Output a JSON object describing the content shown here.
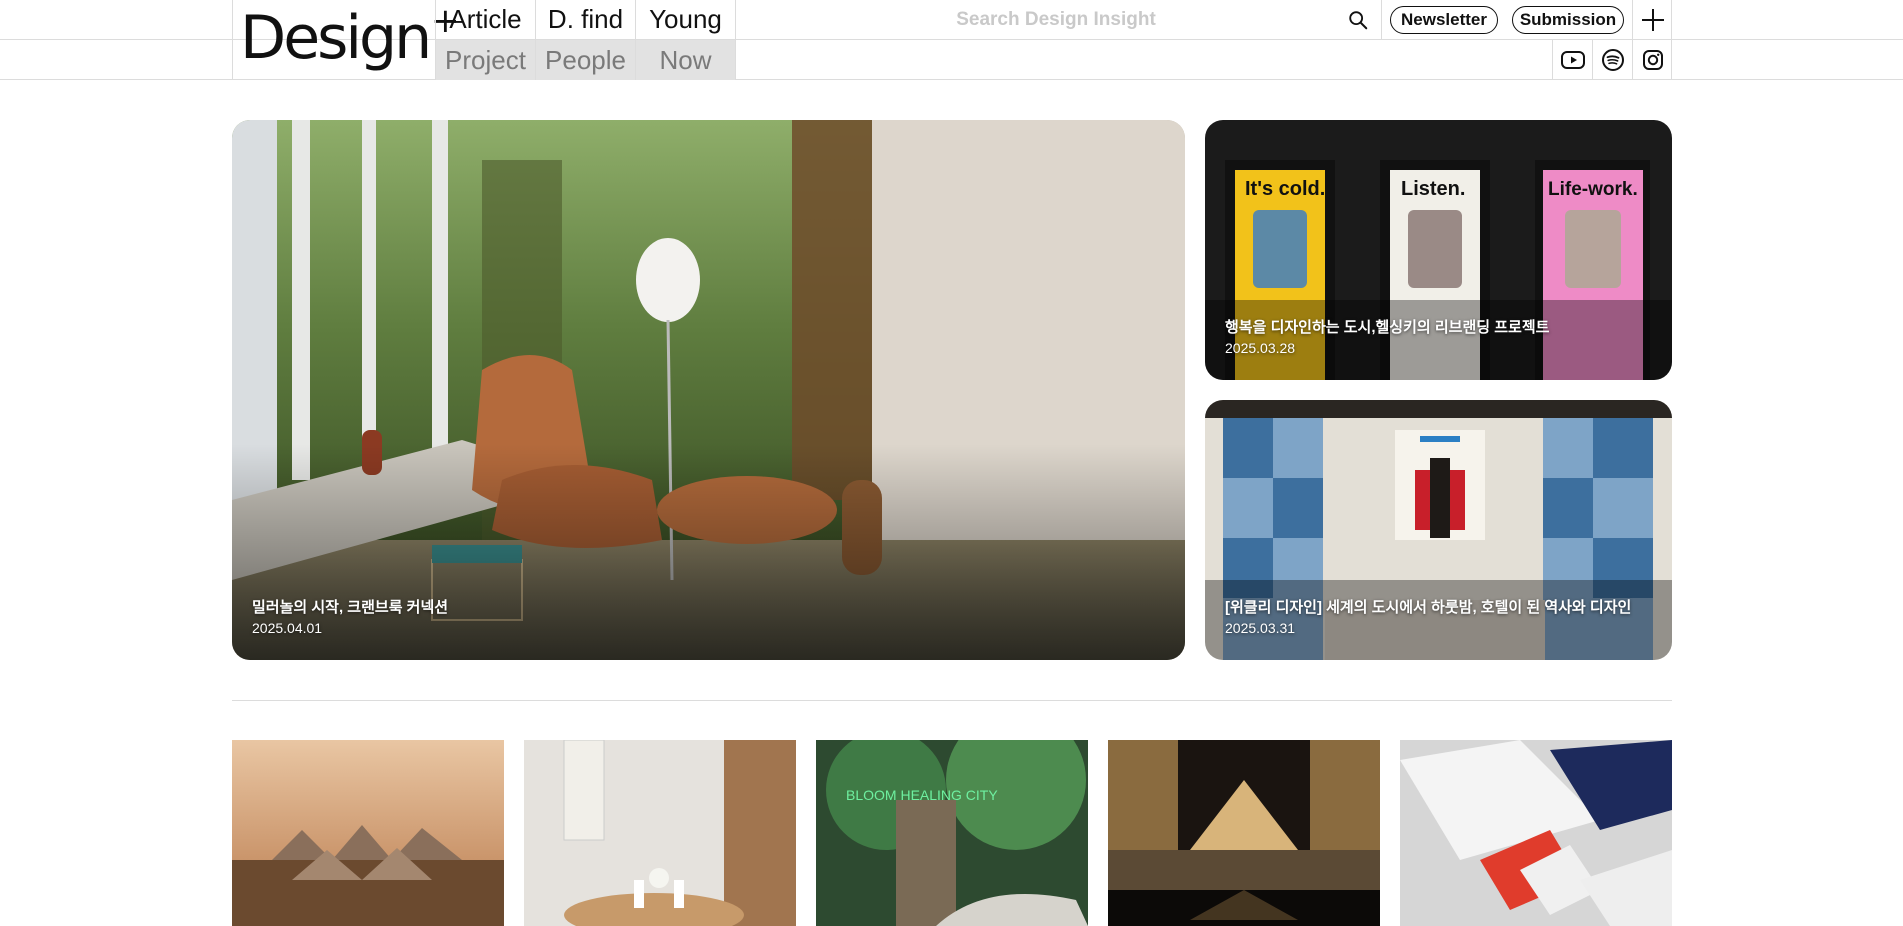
{
  "header": {
    "logo_text": "Design",
    "logo_plus": "+",
    "nav": [
      {
        "top": "Article",
        "bottom": "Project"
      },
      {
        "top": "D. find",
        "bottom": "People"
      },
      {
        "top": "Young",
        "bottom": "Now"
      }
    ],
    "search": {
      "placeholder": "Search Design Insight",
      "value": ""
    },
    "newsletter_label": "Newsletter",
    "submission_label": "Submission",
    "icons": [
      "search-icon",
      "plus-icon",
      "youtube-icon",
      "spotify-icon",
      "instagram-icon"
    ]
  },
  "hero": {
    "main": {
      "title": "밀러놀의 시작, 크랜브룩 커넥션",
      "date": "2025.04.01"
    },
    "side": [
      {
        "title": "행복을 디자인하는 도시,헬싱키의 리브랜딩 프로젝트",
        "date": "2025.03.28",
        "posters": [
          "It's cold.",
          "Listen.",
          "Life-work."
        ]
      },
      {
        "title": "[위클리 디자인] 세계의 도시에서 하룻밤, 호텔이 된 역사와 디자인",
        "date": "2025.03.31"
      }
    ]
  },
  "thumbnails": [
    {
      "alt": "aerial-architecture"
    },
    {
      "alt": "interior-products"
    },
    {
      "alt": "garden-exhibition",
      "sign": "BLOOM HEALING CITY"
    },
    {
      "alt": "immersive-pyramid"
    },
    {
      "alt": "branding-stationery"
    }
  ],
  "colors": {
    "border": "#dcdcdc",
    "nav_sub_bg": "#e2e2e2",
    "text": "#111111"
  }
}
